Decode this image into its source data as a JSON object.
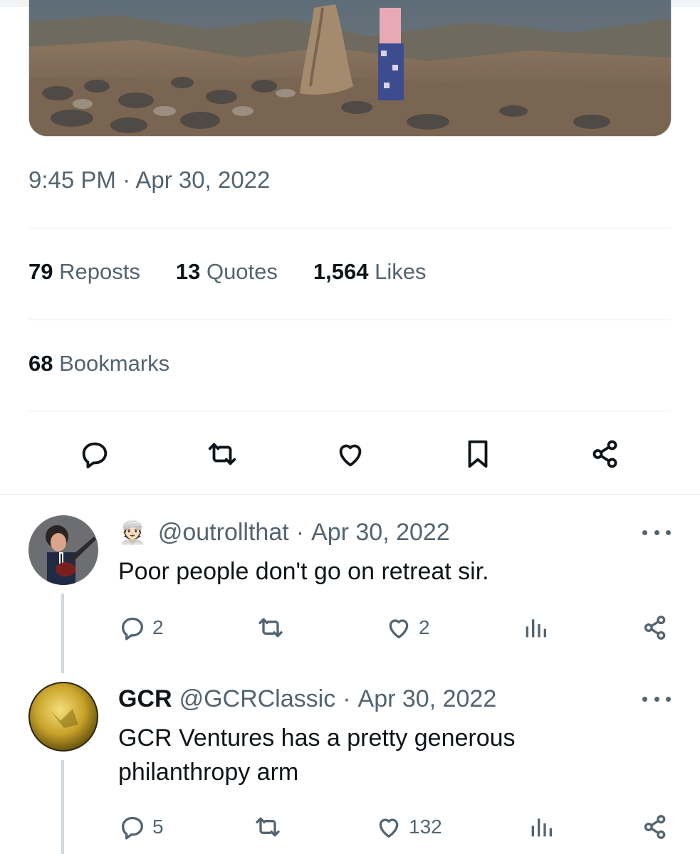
{
  "tweet": {
    "timestamp": "9:45 PM · Apr 30, 2022",
    "stats": {
      "reposts": {
        "count": "79",
        "label": "Reposts"
      },
      "quotes": {
        "count": "13",
        "label": "Quotes"
      },
      "likes": {
        "count": "1,564",
        "label": "Likes"
      },
      "bookmarks": {
        "count": "68",
        "label": "Bookmarks"
      }
    },
    "actions": [
      "reply-icon",
      "repost-icon",
      "like-icon",
      "bookmark-icon",
      "share-icon"
    ]
  },
  "replies": [
    {
      "name": "",
      "emoji": "👳🏻",
      "handle": "@outrollthat",
      "separator": "·",
      "date": "Apr 30, 2022",
      "text": "Poor people don't go on retreat sir.",
      "reply_count": "2",
      "repost_count": "",
      "like_count": "2"
    },
    {
      "name": "GCR",
      "handle": "@GCRClassic",
      "separator": "·",
      "date": "Apr 30, 2022",
      "text": "GCR Ventures has a pretty generous philanthropy arm",
      "reply_count": "5",
      "repost_count": "",
      "like_count": "132"
    }
  ],
  "colors": {
    "text_primary": "#0f1419",
    "text_secondary": "#536471",
    "divider": "#e7eaec"
  }
}
